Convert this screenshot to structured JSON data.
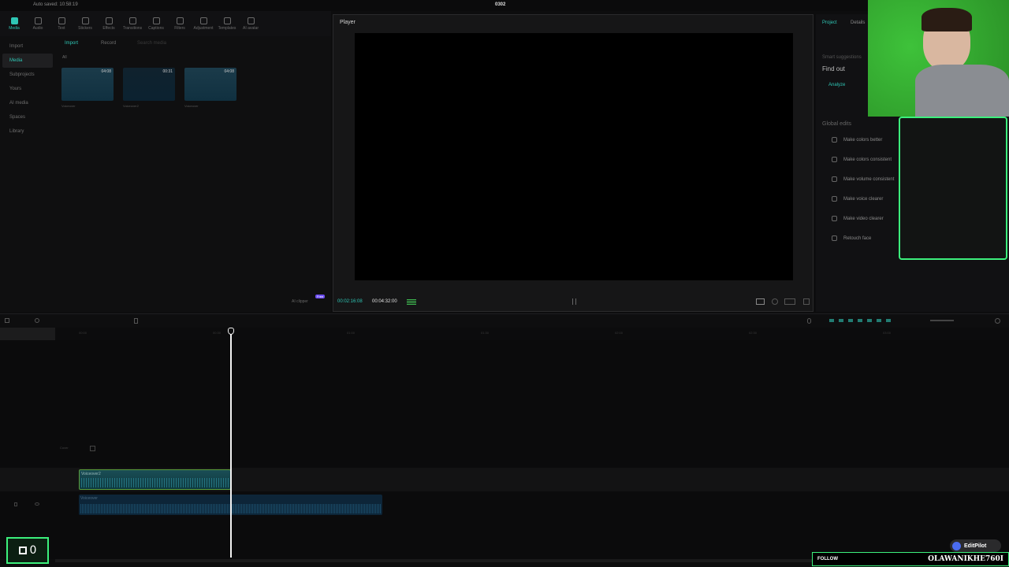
{
  "titlebar": {
    "autosave": "Auto saved: 10:58:19",
    "project_name": "0302"
  },
  "toolbar": [
    {
      "label": "Media"
    },
    {
      "label": "Audio"
    },
    {
      "label": "Text"
    },
    {
      "label": "Stickers"
    },
    {
      "label": "Effects"
    },
    {
      "label": "Transitions"
    },
    {
      "label": "Captions"
    },
    {
      "label": "Filters"
    },
    {
      "label": "Adjustment"
    },
    {
      "label": "Templates"
    },
    {
      "label": "AI avatar"
    }
  ],
  "leftnav": [
    "Import",
    "Media",
    "Subprojects",
    "Yours",
    "AI media",
    "Spaces",
    "Library"
  ],
  "media": {
    "import_label": "Import",
    "record_label": "Record",
    "search_placeholder": "Search media",
    "all_label": "All",
    "thumbs": [
      {
        "duration": "04:08",
        "label": "Voiceover"
      },
      {
        "duration": "00:31",
        "label": "Voiceover2"
      },
      {
        "duration": "04:08",
        "label": "Voiceover"
      }
    ],
    "ai_label": "AI clipper",
    "ai_badge": "Free"
  },
  "player": {
    "title": "Player",
    "current_time": "00:02:16:08",
    "total_time": "00:04:32:00"
  },
  "right_panel": {
    "tabs": [
      "Project",
      "Details"
    ],
    "smart_title": "Smart suggestions",
    "find_out": "Find out",
    "analyze": "Analyze",
    "global_edits": "Global edits",
    "edits": [
      {
        "label": "Make colors better",
        "icon": "magic-wand-icon"
      },
      {
        "label": "Make colors consistent",
        "icon": "palette-icon"
      },
      {
        "label": "Make volume consistent",
        "icon": "sliders-icon"
      },
      {
        "label": "Make voice clearer",
        "icon": "voice-icon"
      },
      {
        "label": "Make video clearer",
        "icon": "hd-icon"
      },
      {
        "label": "Retouch face",
        "icon": "face-icon"
      }
    ]
  },
  "timeline": {
    "ruler_marks": [
      "00:00",
      "00:30",
      "01:00",
      "01:30",
      "02:00",
      "02:30",
      "03:00",
      "03:30"
    ],
    "cover_label": "Cover",
    "clip_video_label": "Voiceover2",
    "clip_audio_label": "Voiceover"
  },
  "overlay": {
    "counter": "0",
    "follow": "FOLLOW",
    "handle": "OLAWANIKHE760I",
    "editpilot": "EditPilot"
  }
}
